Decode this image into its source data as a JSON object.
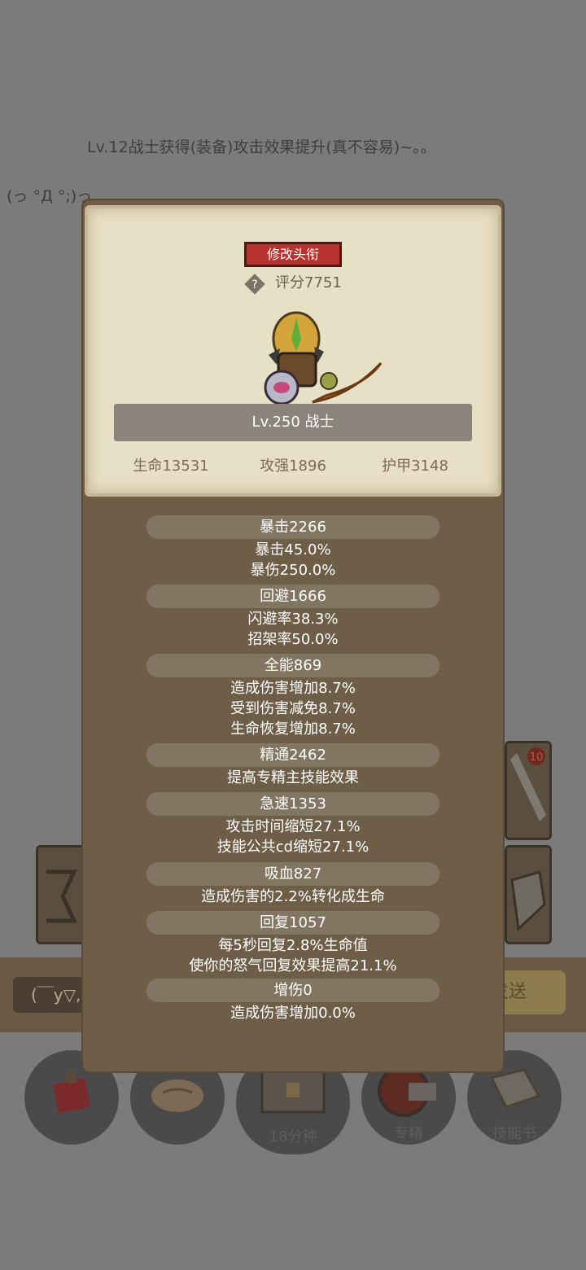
{
  "background": {
    "chat_line_1": "Lv.12战士获得(装备)攻击效果提升(真不容易)~。。",
    "chat_line_2": "(っ °Д °;)っ",
    "input_placeholder": "(￣y▽,",
    "send_label": "发送",
    "timer_label": "18分钟",
    "specialization_label": "专精",
    "skillbook_label": "技能书",
    "badge_number": "10"
  },
  "header": {
    "change_title_label": "修改头衔",
    "score_label": "评分7751"
  },
  "character": {
    "level_class": "Lv.250 战士"
  },
  "basic_stats": [
    {
      "label": "生命13531"
    },
    {
      "label": "攻强1896"
    },
    {
      "label": "护甲3148"
    }
  ],
  "stats": [
    {
      "name": "暴击2266",
      "details": [
        "暴击45.0%",
        "暴伤250.0%"
      ]
    },
    {
      "name": "回避1666",
      "details": [
        "闪避率38.3%",
        "招架率50.0%"
      ]
    },
    {
      "name": "全能869",
      "details": [
        "造成伤害增加8.7%",
        "受到伤害减免8.7%",
        "生命恢复增加8.7%"
      ]
    },
    {
      "name": "精通2462",
      "details": [
        "提高专精主技能效果"
      ]
    },
    {
      "name": "急速1353",
      "details": [
        "攻击时间缩短27.1%",
        "技能公共cd缩短27.1%"
      ]
    },
    {
      "name": "吸血827",
      "details": [
        "造成伤害的2.2%转化成生命"
      ]
    },
    {
      "name": "回复1057",
      "details": [
        "每5秒回复2.8%生命值",
        "使你的怒气回复效果提高21.1%"
      ]
    },
    {
      "name": "增伤0",
      "details": [
        "造成伤害增加0.0%"
      ]
    }
  ],
  "colors": {
    "title_button": "#b7322e",
    "paper": "#e8dfc7",
    "panel": "#6e5e48",
    "stat_bar": "#827562"
  },
  "icons": [
    "help-icon",
    "warrior-avatar",
    "potion-icon",
    "bread-icon",
    "chest-icon",
    "specialization-icon",
    "skill-book-icon",
    "sword-icon",
    "shield-icon"
  ]
}
